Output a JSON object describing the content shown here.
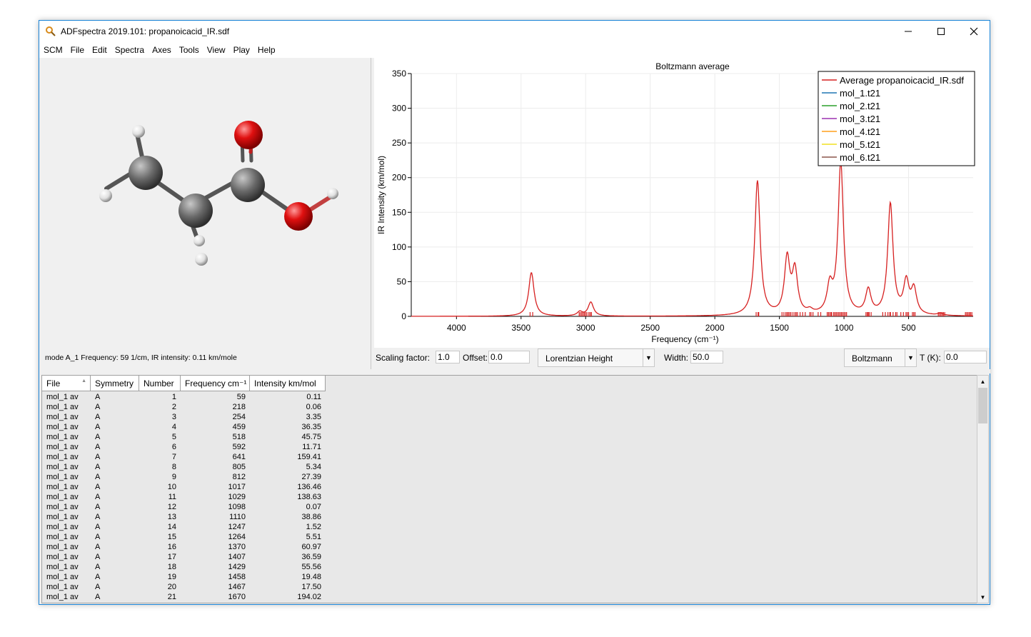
{
  "window": {
    "title": "ADFspectra 2019.101: propanoicacid_IR.sdf"
  },
  "menu": [
    "SCM",
    "File",
    "Edit",
    "Spectra",
    "Axes",
    "Tools",
    "View",
    "Play",
    "Help"
  ],
  "molecule": {
    "status": "mode A_1 Frequency:   59 1/cm, IR intensity:   0.11 km/mole"
  },
  "controls": {
    "scaling_label": "Scaling factor:",
    "scaling_value": "1.0",
    "offset_label": "Offset:",
    "offset_value": "0.0",
    "lineshape": "Lorentzian Height",
    "width_label": "Width:",
    "width_value": "50.0",
    "averaging": "Boltzmann",
    "temp_label": "T (K):",
    "temp_value": "0.0"
  },
  "table": {
    "headers": [
      "File",
      "Symmetry",
      "Number",
      "Frequency cm⁻¹",
      "Intensity km/mol"
    ],
    "rows": [
      [
        "mol_1 av",
        "A",
        "1",
        "59",
        "0.11"
      ],
      [
        "mol_1 av",
        "A",
        "2",
        "218",
        "0.06"
      ],
      [
        "mol_1 av",
        "A",
        "3",
        "254",
        "3.35"
      ],
      [
        "mol_1 av",
        "A",
        "4",
        "459",
        "36.35"
      ],
      [
        "mol_1 av",
        "A",
        "5",
        "518",
        "45.75"
      ],
      [
        "mol_1 av",
        "A",
        "6",
        "592",
        "11.71"
      ],
      [
        "mol_1 av",
        "A",
        "7",
        "641",
        "159.41"
      ],
      [
        "mol_1 av",
        "A",
        "8",
        "805",
        "5.34"
      ],
      [
        "mol_1 av",
        "A",
        "9",
        "812",
        "27.39"
      ],
      [
        "mol_1 av",
        "A",
        "10",
        "1017",
        "136.46"
      ],
      [
        "mol_1 av",
        "A",
        "11",
        "1029",
        "138.63"
      ],
      [
        "mol_1 av",
        "A",
        "12",
        "1098",
        "0.07"
      ],
      [
        "mol_1 av",
        "A",
        "13",
        "1110",
        "38.86"
      ],
      [
        "mol_1 av",
        "A",
        "14",
        "1247",
        "1.52"
      ],
      [
        "mol_1 av",
        "A",
        "15",
        "1264",
        "5.51"
      ],
      [
        "mol_1 av",
        "A",
        "16",
        "1370",
        "60.97"
      ],
      [
        "mol_1 av",
        "A",
        "17",
        "1407",
        "36.59"
      ],
      [
        "mol_1 av",
        "A",
        "18",
        "1429",
        "55.56"
      ],
      [
        "mol_1 av",
        "A",
        "19",
        "1458",
        "19.48"
      ],
      [
        "mol_1 av",
        "A",
        "20",
        "1467",
        "17.50"
      ],
      [
        "mol_1 av",
        "A",
        "21",
        "1670",
        "194.02"
      ]
    ]
  },
  "colors": {
    "spectrum": "#d62020",
    "accent": "#1883d7"
  },
  "chart_data": {
    "type": "line",
    "title": "Boltzmann average",
    "xlabel": "Frequency (cm⁻¹)",
    "ylabel": "IR Intensity (km/mol)",
    "xlim": [
      4350,
      0
    ],
    "ylim": [
      0,
      350
    ],
    "xticks": [
      4000,
      3500,
      3000,
      2500,
      2000,
      1500,
      1000,
      500
    ],
    "yticks": [
      0,
      50,
      100,
      150,
      200,
      250,
      300,
      350
    ],
    "grid": true,
    "legend_position": "top-right",
    "legend": [
      {
        "name": "Average propanoicacid_IR.sdf",
        "color": "#d62020"
      },
      {
        "name": "mol_1.t21",
        "color": "#1f77b4"
      },
      {
        "name": "mol_2.t21",
        "color": "#2ca02c"
      },
      {
        "name": "mol_3.t21",
        "color": "#9b30b0"
      },
      {
        "name": "mol_4.t21",
        "color": "#ff9f1c"
      },
      {
        "name": "mol_5.t21",
        "color": "#f0e020"
      },
      {
        "name": "mol_6.t21",
        "color": "#8c564b"
      }
    ],
    "peak_model": "lorentzian",
    "peaks": [
      {
        "x": 3420,
        "height": 63
      },
      {
        "x": 3045,
        "height": 6
      },
      {
        "x": 2960,
        "height": 20
      },
      {
        "x": 1670,
        "height": 194
      },
      {
        "x": 1440,
        "height": 80
      },
      {
        "x": 1380,
        "height": 62
      },
      {
        "x": 1264,
        "height": 5
      },
      {
        "x": 1110,
        "height": 38
      },
      {
        "x": 1025,
        "height": 220
      },
      {
        "x": 812,
        "height": 35
      },
      {
        "x": 641,
        "height": 160
      },
      {
        "x": 518,
        "height": 46
      },
      {
        "x": 459,
        "height": 36
      },
      {
        "x": 254,
        "height": 3
      }
    ]
  }
}
